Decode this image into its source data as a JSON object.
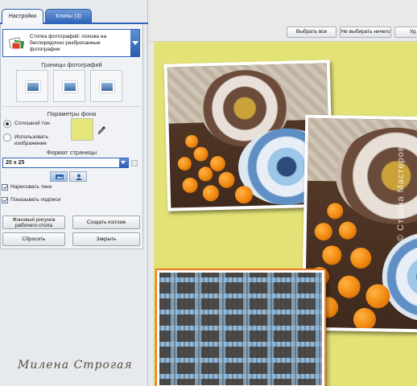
{
  "tabs": {
    "settings": "Настройки",
    "clips": "Клипы (3)"
  },
  "style": {
    "label": "Стопка фотографий: похожа на беспорядочно разбросанные фотографии"
  },
  "borders": {
    "title": "Границы фотографий"
  },
  "background": {
    "title": "Параметры фона",
    "solid_label": "Сплошной тон",
    "image_label": "Использовать изображение",
    "color": "#e4e57a"
  },
  "page_format": {
    "title": "Формат страницы",
    "value": "20 x 25"
  },
  "options": {
    "shadows_label": "Нарисовать тени",
    "captions_label": "Показывать подписи"
  },
  "buttons": {
    "wallpaper": "Фоновый рисунок рабочего стола",
    "create_collage": "Создать коллаж",
    "reset": "Сбросить",
    "close": "Закрыть"
  },
  "toolbar": {
    "select_all": "Выбрать все",
    "select_none": "Не выбирать ничего",
    "delete": "Уд"
  },
  "watermark": "© Страна Мастеров",
  "signature": "Милена Строгая",
  "canvas": {
    "background": "#e3e276",
    "selected_border": "#f07a22"
  }
}
